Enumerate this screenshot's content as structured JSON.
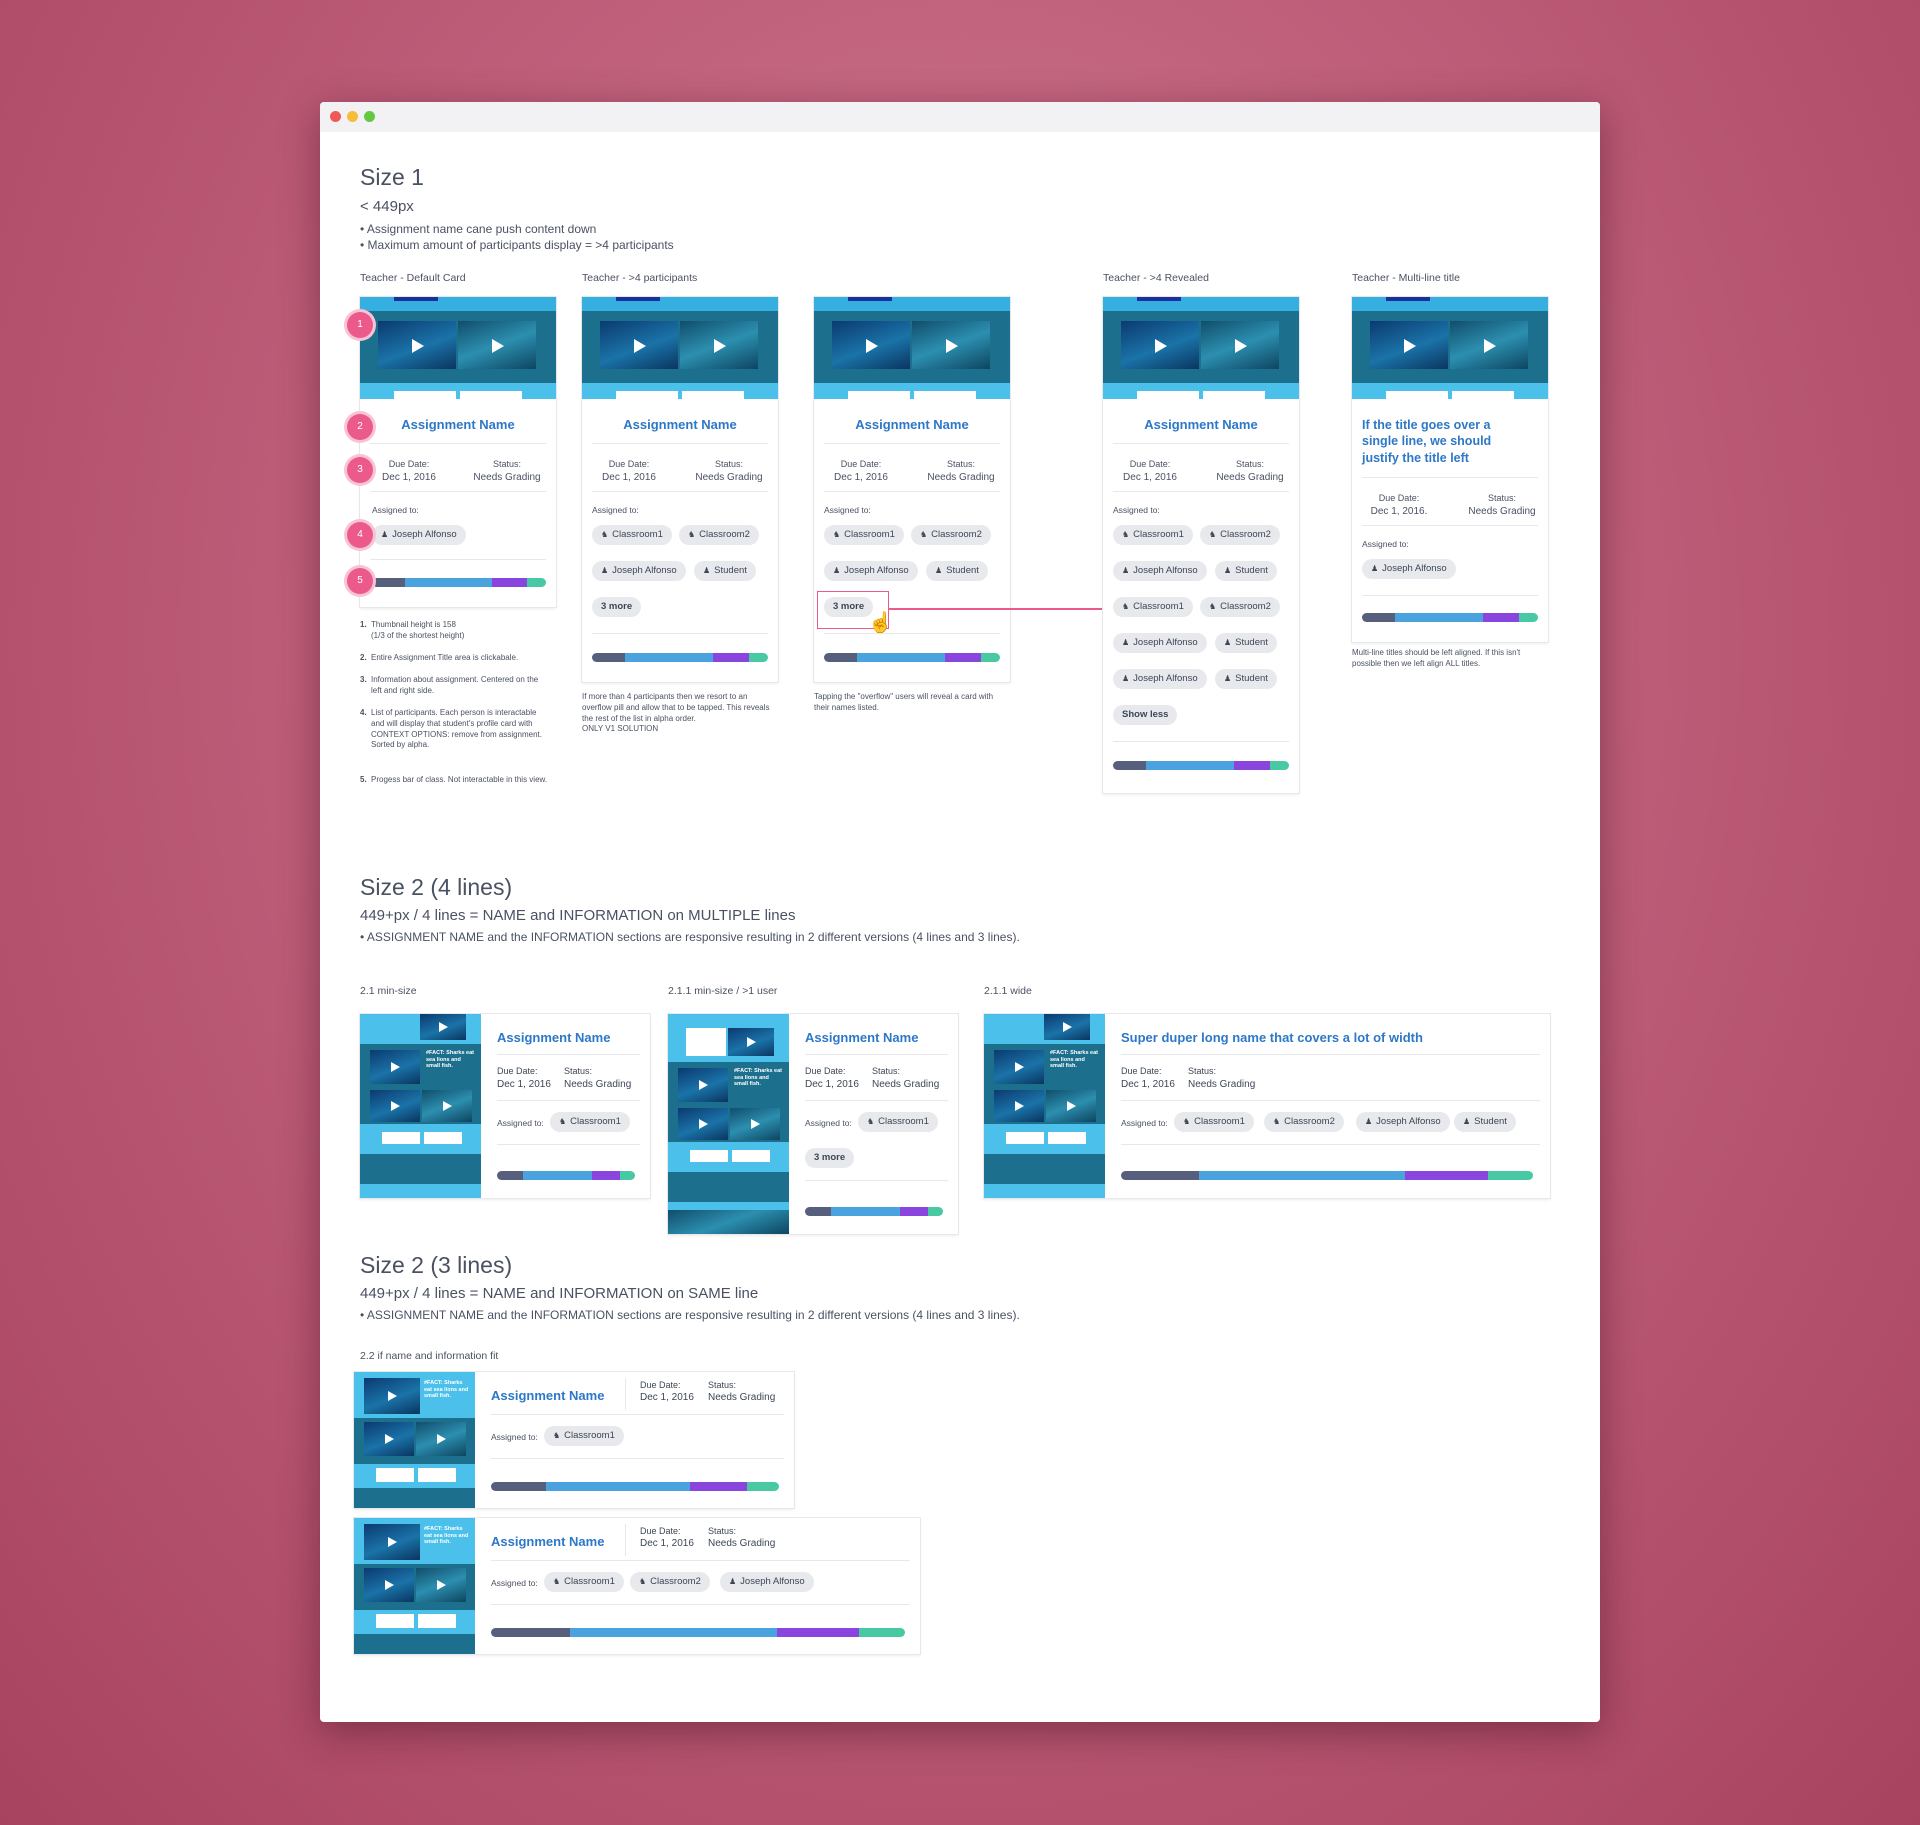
{
  "window": {
    "dots": {
      "red": "#ee5b57",
      "yellow": "#f5bd3a",
      "green": "#64c842"
    }
  },
  "size1": {
    "title": "Size 1",
    "subtitle": "< 449px",
    "bullets": [
      "• Assignment name cane push content down",
      "• Maximum amount of participants display = >4 participants"
    ]
  },
  "labels": {
    "default_card": "Teacher - Default Card",
    "gt4": "Teacher - >4 participants",
    "revealed": "Teacher - >4 Revealed",
    "multiline": "Teacher - Multi-line title"
  },
  "card": {
    "name": "Assignment Name",
    "due_label": "Due Date:",
    "due_value": "Dec 1, 2016",
    "due_value_alt": "Dec 1, 2016.",
    "status_label": "Status:",
    "status_value": "Needs Grading",
    "assigned_label": "Assigned to:",
    "multiline_title": "If the title goes over a single line, we should justify the title left",
    "wide_title": "Super duper long name that covers a lot of width"
  },
  "pills": {
    "classroom1": "Classroom1",
    "classroom2": "Classroom2",
    "joseph": "Joseph Alfonso",
    "student": "Student",
    "more": "3 more",
    "show_less": "Show less"
  },
  "icons": {
    "group": "group-icon",
    "person": "person-icon",
    "cursor": "hand-pointer-icon"
  },
  "markers": [
    "1",
    "2",
    "3",
    "4",
    "5"
  ],
  "notes": [
    {
      "n": "1.",
      "t": "Thumbnail height is 158\n(1/3 of the shortest height)"
    },
    {
      "n": "2.",
      "t": "Entire Assignment Title area is clickabale."
    },
    {
      "n": "3.",
      "t": "Information about assignment. Centered on the left and right side."
    },
    {
      "n": "4.",
      "t": "List of participants. Each person is interactable and will display that student's profile card with CONTEXT OPTIONS: remove from assignment.\nSorted by alpha."
    },
    {
      "n": "5.",
      "t": "Progess bar of class. Not interactable in this view."
    }
  ],
  "captions": {
    "gt4": "If more than 4 participants then we resort to an overflow pill and allow that to be tapped. This reveals the rest of the list in alpha order.\nONLY V1 SOLUTION",
    "tap": "Tapping the \"overflow\" users will reveal a card with their names listed.",
    "multiline": "Multi-line titles should be left aligned. If this isn't possible then we left align ALL titles."
  },
  "size2a": {
    "title": "Size 2 (4 lines)",
    "subtitle": "449+px / 4 lines = NAME and INFORMATION on MULTIPLE lines",
    "bullet": "• ASSIGNMENT NAME and the INFORMATION sections are responsive resulting in 2 different versions (4 lines and 3 lines).",
    "label_min": "2.1 min-size",
    "label_user": "2.1.1 min-size / >1 user",
    "label_wide": "2.1.1 wide"
  },
  "size2b": {
    "title": "Size 2 (3 lines)",
    "subtitle": "449+px / 4 lines = NAME and INFORMATION on SAME line",
    "bullet": "• ASSIGNMENT NAME and the INFORMATION sections are responsive resulting in 2 different versions (4 lines and 3 lines).",
    "label_fit": "2.2 if name and information fit"
  },
  "thumb_fact": "#FACT: Sharks eat sea lions and small fish.",
  "progress": {
    "segments": [
      0.19,
      0.5,
      0.2,
      0.11
    ],
    "colors": [
      "#56607c",
      "#4aa3de",
      "#8a45de",
      "#49c9a3"
    ]
  },
  "accent": "#ec5a8c",
  "title_color": "#2d78c8"
}
